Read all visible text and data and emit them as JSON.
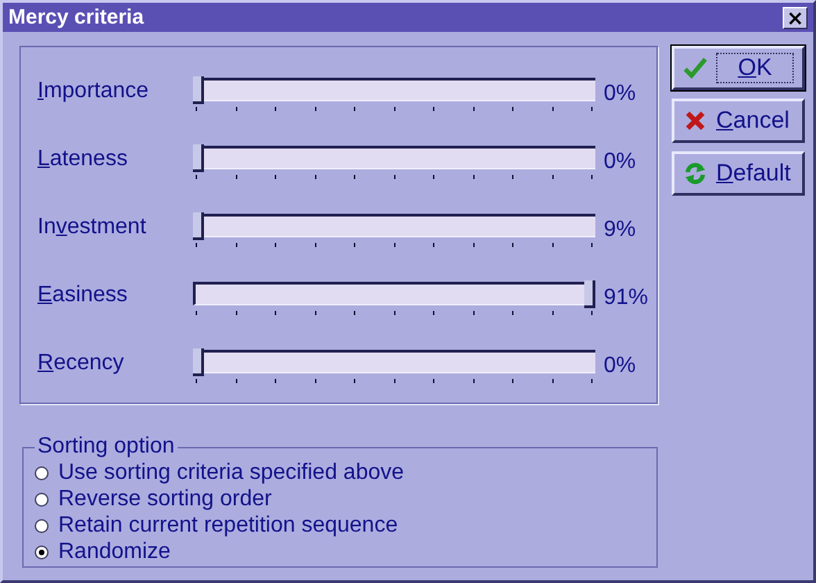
{
  "window": {
    "title": "Mercy criteria",
    "close": "×"
  },
  "criteria": [
    {
      "label": {
        "key": "I",
        "post": "mportance"
      },
      "level": 0,
      "reading": "0%"
    },
    {
      "label": {
        "key": "L",
        "post": "ateness"
      },
      "level": 0,
      "reading": "0%"
    },
    {
      "label": {
        "pre": "In",
        "key": "v",
        "post": "estment"
      },
      "level": 0,
      "reading": "9%"
    },
    {
      "label": {
        "key": "E",
        "post": "asiness"
      },
      "level": 1,
      "reading": "91%"
    },
    {
      "label": {
        "key": "R",
        "post": "ecency"
      },
      "level": 0,
      "reading": "0%"
    }
  ],
  "buttons": [
    {
      "kind": "ok",
      "label": {
        "key": "O",
        "post": "K"
      },
      "focused": true
    },
    {
      "kind": "cancel",
      "label": {
        "key": "C",
        "post": "ancel"
      },
      "focused": false
    },
    {
      "kind": "default",
      "label": {
        "key": "D",
        "post": "efault"
      },
      "focused": false
    }
  ],
  "sorting": {
    "title": "Sorting option",
    "options": [
      {
        "label": "Use sorting criteria specified above",
        "selected": false
      },
      {
        "label": "Reverse sorting order",
        "selected": false
      },
      {
        "label": "Retain current repetition sequence",
        "selected": false
      },
      {
        "label": "Randomize",
        "selected": true
      }
    ]
  }
}
